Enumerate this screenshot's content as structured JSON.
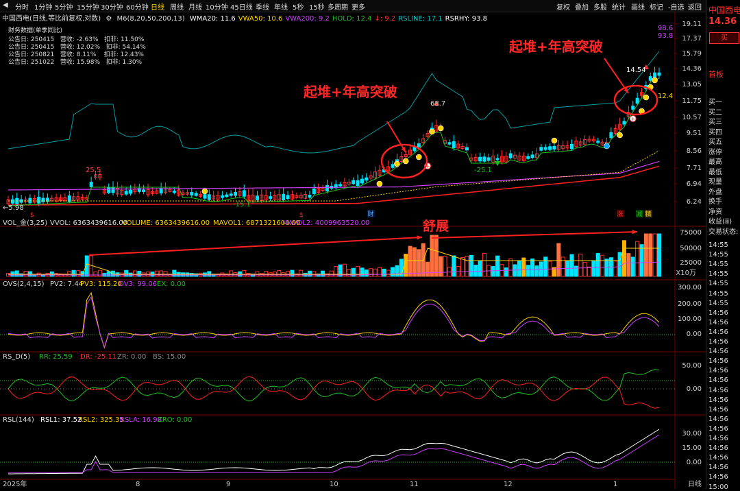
{
  "toolbar": {
    "periods": [
      "分时",
      "1分钟",
      "5分钟",
      "15分钟",
      "30分钟",
      "60分钟",
      "日线",
      "周线",
      "月线",
      "10分钟",
      "45日线",
      "季线",
      "年线",
      "5秒",
      "15秒",
      "多周期",
      "更多"
    ],
    "active": "日线",
    "right_actions": [
      "复权",
      "叠加",
      "多股",
      "统计",
      "画线",
      "标记",
      "-自选",
      "返回"
    ]
  },
  "main_legend": {
    "title": "中国西电(日线,等比前复权,对数)",
    "m6": "M6(8,20,50,200,13)",
    "items": [
      {
        "text": "WMA20: 11.6",
        "color": "#ffffff"
      },
      {
        "text": "VWA50: 10.6",
        "color": "#ffd400"
      },
      {
        "text": "VWA200: 9.2",
        "color": "#d040ff"
      },
      {
        "text": "HOLD: 12.4",
        "color": "#20c020"
      },
      {
        "text": "↓: 9.2",
        "color": "#ff3030"
      },
      {
        "text": "RSLINE: 17.1",
        "color": "#00c8c8"
      },
      {
        "text": "RSRHY: 93.8",
        "color": "#ffffff"
      }
    ]
  },
  "financials": {
    "header": "财务数据(单季同比)",
    "rows": [
      "公告日: 250415   营收: -2.63%   扣非: 11.50%",
      "公告日: 250415   营收: 12.02%   扣非: 54.14%",
      "公告日: 250821   营收: 8.11%    扣非: 12.43%",
      "公告日: 251022   营收: 15.98%   扣非: 1.30%"
    ]
  },
  "annotations": {
    "breakout1": "起堆+年高突破",
    "breakout2": "起堆+年高突破",
    "stretch": "舒展"
  },
  "price_labels": {
    "low": "5.98",
    "p1": "25.5",
    "m1": "-15.1",
    "p2": "68.7",
    "m2": "-25.1",
    "last": "14.54",
    "top1": "98.6",
    "top2": "93.8",
    "hold": "12.4",
    "tag_cai": "财",
    "tag_zhang": "涨",
    "tag_jian": "减",
    "tag_jing": "精",
    "tag_s1": "$",
    "tag_s2": "$"
  },
  "price_axis": [
    "19.11",
    "17.37",
    "15.79",
    "14.36",
    "13.05",
    "11.75",
    "10.57",
    "9.51",
    "8.56",
    "7.71",
    "6.94",
    "6.24"
  ],
  "vol_legend": {
    "name": "VOL_金(3,25)",
    "items": [
      {
        "text": "VVOL: 6363439616.00",
        "color": "#dddddd"
      },
      {
        "text": "VOLUME: 6363439616.00",
        "color": "#ffd400"
      },
      {
        "text": "MAVOL1: 6871321600.00",
        "color": "#ffd400"
      },
      {
        "text": "MAVOL2: 4009963520.00",
        "color": "#d040ff"
      }
    ],
    "axis": [
      "75000",
      "50000",
      "25000"
    ],
    "unit": "X10万"
  },
  "ovs_legend": {
    "name": "OVS(2,4,15)",
    "items": [
      {
        "text": "PV2: 7.44",
        "color": "#dddddd"
      },
      {
        "text": "PV3: 115.20",
        "color": "#ffd400"
      },
      {
        "text": "OV3: 99.06",
        "color": "#d040ff"
      },
      {
        "text": "EX: 0.00",
        "color": "#20c020"
      }
    ],
    "axis": [
      "300.00",
      "200.00",
      "100.00",
      "0.00"
    ]
  },
  "rsd_legend": {
    "name": "RS_D(5)",
    "items": [
      {
        "text": "RR: 25.59",
        "color": "#20c020"
      },
      {
        "text": "DR: -25.11",
        "color": "#ff3030"
      },
      {
        "text": "ZR: 0.00",
        "color": "#888888"
      },
      {
        "text": "BS: 15.00",
        "color": "#888888"
      }
    ],
    "axis": [
      "50.00",
      "0.00"
    ]
  },
  "rsl_legend": {
    "name": "RSL(144)",
    "items": [
      {
        "text": "RSL1: 37.52",
        "color": "#ffffff"
      },
      {
        "text": "RSL2: 325.35",
        "color": "#ffd400"
      },
      {
        "text": "RSLA: 16.98",
        "color": "#d040ff"
      },
      {
        "text": "ZRO: 0.00",
        "color": "#20c020"
      }
    ],
    "axis": [
      "30.00",
      "15.00",
      "0.00"
    ]
  },
  "x_axis": [
    "2025年",
    "8",
    "9",
    "10",
    "11",
    "12",
    "1",
    "日线"
  ],
  "right_panel": {
    "name": "中国西电",
    "price": "14.36",
    "price_suffix": "1",
    "buy_btn": "买",
    "first_board": "首板",
    "quotes": [
      "买一",
      "买二",
      "买三",
      "买四",
      "买五",
      "涨停",
      "最高",
      "最低",
      "现量",
      "外盘",
      "换手",
      "净资",
      "收益(ⅲ)",
      "交易状态:"
    ],
    "times": [
      "14:55",
      "14:55",
      "14:55",
      "14:55",
      "14:55",
      "14:55",
      "14:55",
      "14:56",
      "14:56",
      "14:56",
      "14:56",
      "14:56",
      "14:56",
      "14:56",
      "14:56",
      "14:56",
      "14:56",
      "14:56",
      "14:56",
      "14:56",
      "14:56",
      "14:56",
      "14:56",
      "14:56",
      "14:56"
    ],
    "bottom_time": "15:00"
  },
  "colors": {
    "up": "#ff3030",
    "down": "#00e5ff",
    "accent": "#ff2020",
    "bg": "#000000"
  }
}
